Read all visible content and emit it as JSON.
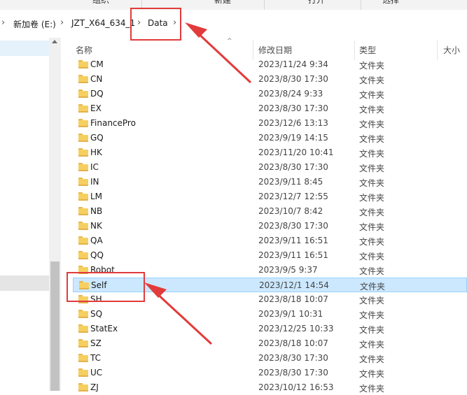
{
  "ribbon": {
    "groups": [
      "组织",
      "新建",
      "打开",
      "选择"
    ]
  },
  "breadcrumb": {
    "items": [
      "新加卷 (E:)",
      "JZT_X64_634_1",
      "Data"
    ]
  },
  "columns": {
    "name": "名称",
    "date": "修改日期",
    "type": "类型",
    "size": "大小"
  },
  "files": [
    {
      "name": "CM",
      "date": "2023/11/24 9:34",
      "type": "文件夹"
    },
    {
      "name": "CN",
      "date": "2023/8/30 17:30",
      "type": "文件夹"
    },
    {
      "name": "DQ",
      "date": "2023/8/24 9:33",
      "type": "文件夹"
    },
    {
      "name": "EX",
      "date": "2023/8/30 17:30",
      "type": "文件夹"
    },
    {
      "name": "FinancePro",
      "date": "2023/12/6 13:13",
      "type": "文件夹"
    },
    {
      "name": "GQ",
      "date": "2023/9/19 14:15",
      "type": "文件夹"
    },
    {
      "name": "HK",
      "date": "2023/11/20 10:41",
      "type": "文件夹"
    },
    {
      "name": "IC",
      "date": "2023/8/30 17:30",
      "type": "文件夹"
    },
    {
      "name": "IN",
      "date": "2023/9/11 8:45",
      "type": "文件夹"
    },
    {
      "name": "LM",
      "date": "2023/12/7 12:55",
      "type": "文件夹"
    },
    {
      "name": "NB",
      "date": "2023/10/7 8:42",
      "type": "文件夹"
    },
    {
      "name": "NK",
      "date": "2023/8/30 17:30",
      "type": "文件夹"
    },
    {
      "name": "QA",
      "date": "2023/9/11 16:51",
      "type": "文件夹"
    },
    {
      "name": "QQ",
      "date": "2023/9/11 16:51",
      "type": "文件夹"
    },
    {
      "name": "Robot",
      "date": "2023/9/5 9:37",
      "type": "文件夹"
    },
    {
      "name": "Self",
      "date": "2023/12/1 14:54",
      "type": "文件夹",
      "selected": true
    },
    {
      "name": "SH",
      "date": "2023/8/18 10:07",
      "type": "文件夹"
    },
    {
      "name": "SQ",
      "date": "2023/9/1 10:31",
      "type": "文件夹"
    },
    {
      "name": "StatEx",
      "date": "2023/12/25 10:33",
      "type": "文件夹"
    },
    {
      "name": "SZ",
      "date": "2023/8/18 10:07",
      "type": "文件夹"
    },
    {
      "name": "TC",
      "date": "2023/8/30 17:30",
      "type": "文件夹"
    },
    {
      "name": "UC",
      "date": "2023/8/30 17:30",
      "type": "文件夹"
    },
    {
      "name": "ZJ",
      "date": "2023/10/12 16:53",
      "type": "文件夹"
    }
  ],
  "colors": {
    "selection": "#cce8ff",
    "annotation": "#e23b3b",
    "folder": "#f6cf61"
  },
  "icons": {
    "folder": "folder-icon",
    "chevron": "chevron-right-icon"
  }
}
